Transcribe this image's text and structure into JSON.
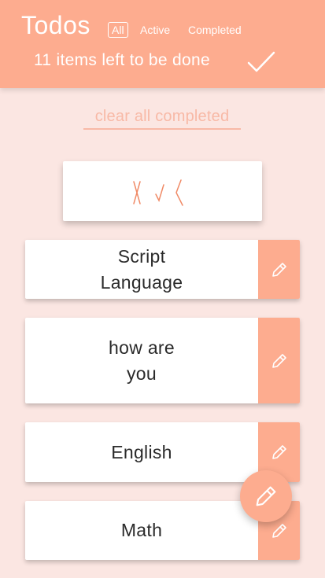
{
  "header": {
    "title": "Todos",
    "filters": [
      {
        "label": "All",
        "active": true
      },
      {
        "label": "Active",
        "active": false
      },
      {
        "label": "Completed",
        "active": false
      }
    ],
    "items_left": "11 items left to be done",
    "check_icon": "check-icon"
  },
  "clear_completed": "clear all completed",
  "input": {
    "icon": "handwriting-icon"
  },
  "todos": [
    {
      "text": "Script Language"
    },
    {
      "text": "how are you"
    },
    {
      "text": "English"
    },
    {
      "text": "Math"
    }
  ],
  "colors": {
    "accent": "#fdac8f",
    "background": "#fbe6e2",
    "text": "#2a2a2a",
    "muted_link": "#f8b9a6"
  }
}
